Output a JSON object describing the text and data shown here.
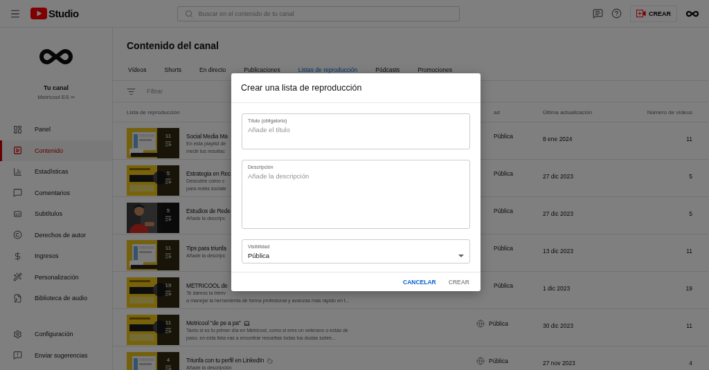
{
  "topbar": {
    "logo_text": "Studio",
    "search": {
      "placeholder": "Buscar en el contenido de tu canal"
    },
    "create_button": "CREAR"
  },
  "sidebar": {
    "channel_title": "Tu canal",
    "channel_name": "Metricool ES ∞",
    "items": [
      {
        "label": "Panel",
        "selected": false
      },
      {
        "label": "Contenido",
        "selected": true
      },
      {
        "label": "Estadísticas",
        "selected": false
      },
      {
        "label": "Comentarios",
        "selected": false
      },
      {
        "label": "Subtítulos",
        "selected": false
      },
      {
        "label": "Derechos de autor",
        "selected": false
      },
      {
        "label": "Ingresos",
        "selected": false
      },
      {
        "label": "Personalización",
        "selected": false
      },
      {
        "label": "Biblioteca de audio",
        "selected": false
      }
    ],
    "bottom_items": [
      {
        "label": "Configuración"
      },
      {
        "label": "Enviar sugerencias"
      }
    ]
  },
  "page_title": "Contenido del canal",
  "tabs": [
    {
      "label": "Vídeos",
      "selected": false
    },
    {
      "label": "Shorts",
      "selected": false
    },
    {
      "label": "En directo",
      "selected": false
    },
    {
      "label": "Publicaciones",
      "selected": false
    },
    {
      "label": "Listas de reproducción",
      "selected": true
    },
    {
      "label": "Pódcasts",
      "selected": false
    },
    {
      "label": "Promociones",
      "selected": false
    }
  ],
  "filter": {
    "placeholder": "Filtrar"
  },
  "table": {
    "columns": [
      "Lista de reproducción",
      "ad",
      "Última actualización",
      "Número de vídeos"
    ],
    "rows": [
      {
        "thumb_count": "11",
        "title": "Social Media Ma",
        "description_lines": [
          "En esta playlist de",
          "medir tus resultac"
        ],
        "visibility": "Pública",
        "globe": false,
        "updated": "8 ene 2024",
        "videos": "11"
      },
      {
        "thumb_count": "5",
        "title": "Estrategia en Rec",
        "description_lines": [
          "Descubre cómo c",
          "para redes sociale"
        ],
        "visibility": "Pública",
        "globe": false,
        "updated": "27 dic 2023",
        "videos": "5"
      },
      {
        "thumb_count": "5",
        "title": "Estudios de Rede",
        "description_lines": [
          "Añade la descripc"
        ],
        "visibility": "Pública",
        "globe": false,
        "updated": "27 dic 2023",
        "videos": "5"
      },
      {
        "thumb_count": "11",
        "title": "Tips para triunfa",
        "description_lines": [
          "Añade la descripc"
        ],
        "visibility": "Pública",
        "globe": false,
        "updated": "13 dic 2023",
        "videos": "11"
      },
      {
        "thumb_count": "19",
        "title": "METRICOOL de",
        "description_lines": [
          "Te damos la bienv",
          "a manejar la herramienta de forma profesional y avanzas más rápido en t..."
        ],
        "visibility": "Pública",
        "globe": false,
        "updated": "1 dic 2023",
        "videos": "19"
      },
      {
        "thumb_count": "11",
        "title": "Metricool \"de pe a pa\"",
        "title_icon": true,
        "description_lines": [
          "Tanto si es tu primer día en Metricool, como si eres un veterano o estás de",
          "paso, en esta lista vas a encontrar resueltas todas tus dudas sobre..."
        ],
        "visibility": "Pública",
        "globe": true,
        "updated": "30 dic 2023",
        "videos": "11"
      },
      {
        "thumb_count": "4",
        "title": "Triunfa con tu perfil en LinkedIn",
        "title_icon": true,
        "description_lines": [
          "Añade la descripción"
        ],
        "visibility": "Pública",
        "globe": true,
        "updated": "27 nov 2023",
        "videos": "4"
      }
    ]
  },
  "dialog": {
    "title": "Crear una lista de reproducción",
    "title_field": {
      "label": "Título (obligatorio)",
      "placeholder": "Añade el título"
    },
    "description_field": {
      "label": "Descripción",
      "placeholder": "Añade la descripción"
    },
    "visibility_field": {
      "label": "Visibilidad",
      "value": "Pública"
    },
    "buttons": [
      {
        "label": "CANCELAR",
        "disabled": false
      },
      {
        "label": "CREAR",
        "disabled": true
      }
    ]
  }
}
